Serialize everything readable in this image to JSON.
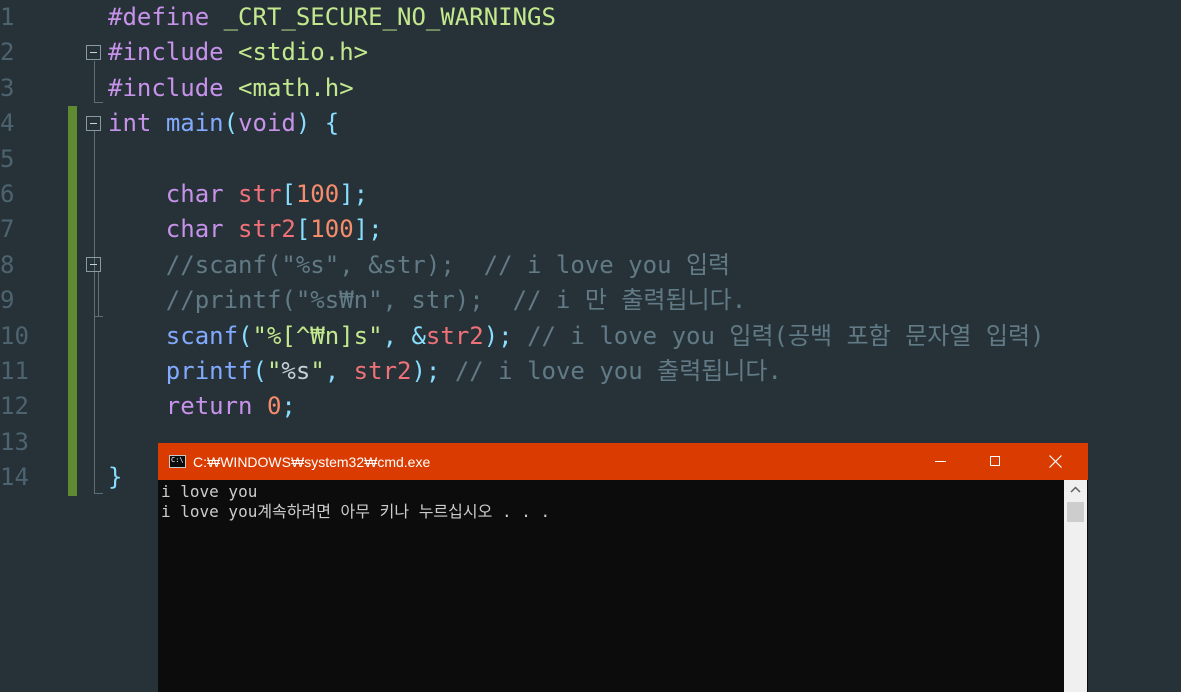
{
  "editor": {
    "line_numbers": [
      "1",
      "2",
      "3",
      "4",
      "5",
      "6",
      "7",
      "8",
      "9",
      "10",
      "11",
      "12",
      "13",
      "14"
    ],
    "lines": [
      [
        {
          "t": "#define",
          "c": "pp"
        },
        {
          "t": " ",
          "c": "plain"
        },
        {
          "t": "_CRT_SECURE_NO_WARNINGS",
          "c": "macro"
        }
      ],
      [
        {
          "t": "#include",
          "c": "pp"
        },
        {
          "t": " ",
          "c": "plain"
        },
        {
          "t": "<stdio.h>",
          "c": "hdr"
        }
      ],
      [
        {
          "t": "#include",
          "c": "pp"
        },
        {
          "t": " ",
          "c": "plain"
        },
        {
          "t": "<math.h>",
          "c": "hdr"
        }
      ],
      [
        {
          "t": "int",
          "c": "kw"
        },
        {
          "t": " ",
          "c": "plain"
        },
        {
          "t": "main",
          "c": "fn"
        },
        {
          "t": "(",
          "c": "punc"
        },
        {
          "t": "void",
          "c": "kw"
        },
        {
          "t": ")",
          "c": "punc"
        },
        {
          "t": " ",
          "c": "plain"
        },
        {
          "t": "{",
          "c": "punc"
        }
      ],
      [],
      [
        {
          "t": "    ",
          "c": "plain"
        },
        {
          "t": "char",
          "c": "kw"
        },
        {
          "t": " ",
          "c": "plain"
        },
        {
          "t": "str",
          "c": "var"
        },
        {
          "t": "[",
          "c": "punc"
        },
        {
          "t": "100",
          "c": "num"
        },
        {
          "t": "];",
          "c": "punc"
        }
      ],
      [
        {
          "t": "    ",
          "c": "plain"
        },
        {
          "t": "char",
          "c": "kw"
        },
        {
          "t": " ",
          "c": "plain"
        },
        {
          "t": "str2",
          "c": "var"
        },
        {
          "t": "[",
          "c": "punc"
        },
        {
          "t": "100",
          "c": "num"
        },
        {
          "t": "];",
          "c": "punc"
        }
      ],
      [
        {
          "t": "    ",
          "c": "plain"
        },
        {
          "t": "//scanf(\"%s\", &str);  // i love you 입력",
          "c": "cmt"
        }
      ],
      [
        {
          "t": "    ",
          "c": "plain"
        },
        {
          "t": "//printf(\"%s₩n\", str);  // i 만 출력됩니다.",
          "c": "cmt"
        }
      ],
      [
        {
          "t": "    ",
          "c": "plain"
        },
        {
          "t": "scanf",
          "c": "fn"
        },
        {
          "t": "(",
          "c": "punc"
        },
        {
          "t": "\"",
          "c": "str"
        },
        {
          "t": "%[^₩n]s",
          "c": "str"
        },
        {
          "t": "\"",
          "c": "str"
        },
        {
          "t": ", ",
          "c": "punc"
        },
        {
          "t": "&",
          "c": "punc"
        },
        {
          "t": "str2",
          "c": "var"
        },
        {
          "t": ");",
          "c": "punc"
        },
        {
          "t": " // i love you 입력(공백 포함 문자열 입력)",
          "c": "cmt"
        }
      ],
      [
        {
          "t": "    ",
          "c": "plain"
        },
        {
          "t": "printf",
          "c": "fn"
        },
        {
          "t": "(",
          "c": "punc"
        },
        {
          "t": "\"",
          "c": "str"
        },
        {
          "t": "%s",
          "c": "esc"
        },
        {
          "t": "\"",
          "c": "str"
        },
        {
          "t": ", ",
          "c": "punc"
        },
        {
          "t": "str2",
          "c": "var"
        },
        {
          "t": ");",
          "c": "punc"
        },
        {
          "t": " // i love you 출력됩니다.",
          "c": "cmt"
        }
      ],
      [
        {
          "t": "    ",
          "c": "plain"
        },
        {
          "t": "return",
          "c": "kw"
        },
        {
          "t": " ",
          "c": "plain"
        },
        {
          "t": "0",
          "c": "num"
        },
        {
          "t": ";",
          "c": "punc"
        }
      ],
      [],
      [
        {
          "t": "}",
          "c": "punc"
        }
      ]
    ]
  },
  "console": {
    "title": "C:₩WINDOWS₩system32₩cmd.exe",
    "icon_text": "C:\\",
    "output_lines": [
      "i love you",
      "i love you계속하려면 아무 키나 누르십시오 . . ."
    ]
  }
}
